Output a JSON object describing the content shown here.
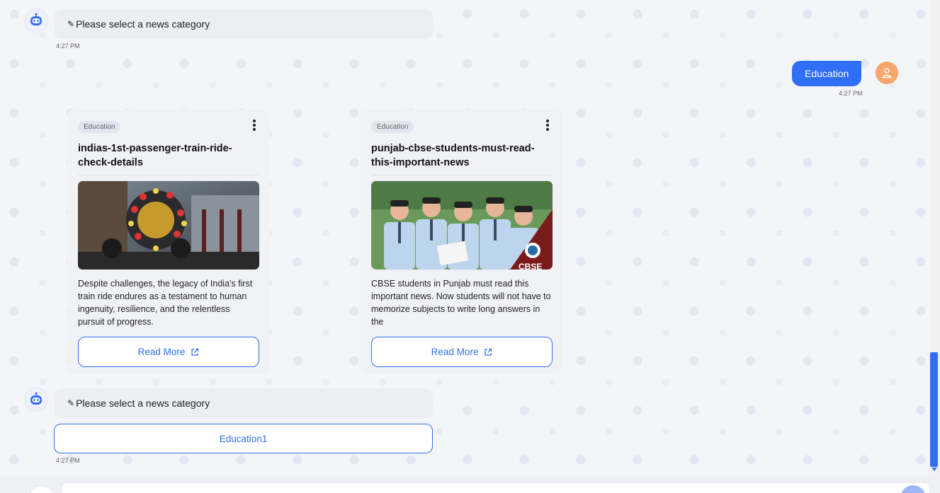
{
  "messages": [
    {
      "type": "bot",
      "prefix": "✎",
      "text": "Please select a news category",
      "time": "4:27 PM"
    },
    {
      "type": "user",
      "text": "Education",
      "time": "4:27 PM"
    },
    {
      "type": "bot",
      "prefix": "✎",
      "text": "Please select a news category",
      "time": "4:27 PM",
      "option": "Education1"
    }
  ],
  "cards": [
    {
      "badge": "Education",
      "title": "indias-1st-passenger-train-ride-check-details",
      "description": "Despite challenges, the legacy of India's first train ride endures as a testament to human ingenuity, resilience, and the relentless pursuit of progress.",
      "button": "Read More"
    },
    {
      "badge": "Education",
      "title": "punjab-cbse-students-must-read-this-important-news",
      "description": "CBSE students in Punjab must read this important news. Now students will not have to memorize subjects to write long answers in the",
      "button": "Read More",
      "image_caption": "CBSE"
    }
  ],
  "colors": {
    "accent": "#2f6ef5",
    "user_avatar": "#f7a66d",
    "bot_bubble": "#eceef4"
  },
  "icons": {
    "bot": "robot-icon",
    "user": "person-icon",
    "menu": "kebab-menu-icon",
    "external": "external-link-icon"
  }
}
